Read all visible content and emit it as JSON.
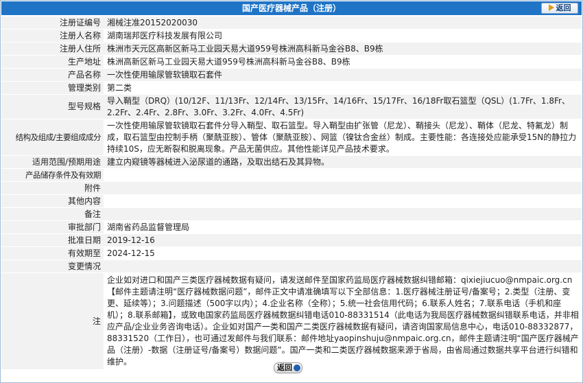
{
  "header": {
    "title": "国产医疗器械产品（注册）",
    "back_label": "返回"
  },
  "rows": [
    {
      "label": "注册证编号",
      "value": "湘械注准20152020030"
    },
    {
      "label": "注册人名称",
      "value": "湖南瑞邦医疗科技发展有限公司"
    },
    {
      "label": "注册人住所",
      "value": "株洲市天元区高新区新马工业园天易大道959号株洲高科新马金谷B8、B9栋"
    },
    {
      "label": "生产地址",
      "value": "株洲高新区新马工业园天易大道959号株洲高科新马金谷B8、B9栋"
    },
    {
      "label": "产品名称",
      "value": "一次性使用输尿管软镜取石套件"
    },
    {
      "label": "管理类别",
      "value": "第二类"
    },
    {
      "label": "型号规格",
      "value": "导入鞘型（DRQ）(10/12F、11/13Fr、12/14Fr、13/15Fr、14/16Fr、15/17Fr、16/18Fr取石篮型（QSL）(1.7Fr、1.8Fr、2.2Fr、2.4Fr、2.8Fr、3.0Fr、3.2Fr、4.0Fr、4.5Fr)"
    },
    {
      "label": "结构及组成/主要组成成分",
      "value": "一次性使用输尿管软镜取石套件分导入鞘型、取石篮型。导入鞘型由扩张管（尼龙）、鞘接头（尼龙）、鞘体（尼龙、特氟龙）制成，取石篮型由控制手柄（聚酰亚胺）、管体（聚酰亚胺）、网篮（镍钛合金丝）制成。主要性能：各连接处应能承受15N的静拉力持续10S，应无断裂和脱离现象。产品无菌供应。其他性能详见产品技术要求。"
    },
    {
      "label": "适用范围/预期用途",
      "value": "建立内窥镜等器械进入泌尿道的通路，及取出结石及其异物。"
    },
    {
      "label": "产品储存条件及有效期",
      "value": ""
    },
    {
      "label": "附件",
      "value": ""
    },
    {
      "label": "其他内容",
      "value": ""
    },
    {
      "label": "备注",
      "value": ""
    },
    {
      "label": "审批部门",
      "value": "湖南省药品监督管理局"
    },
    {
      "label": "批准日期",
      "value": "2019-12-16"
    },
    {
      "label": "有效期至",
      "value": "2024-12-15"
    },
    {
      "label": "变更情况",
      "value": ""
    }
  ],
  "note": {
    "label": "注",
    "text": "企业如对进口和国产三类医疗器械数据有疑问，请发送邮件至国家药监局医疗器械数据纠错邮箱：qixiejiucuo@nmpaic.org.cn【邮件主题请注明“医疗器械数据问题”，邮件正文中请准确填写以下全部信息：1.医疗器械注册证号/备案号；2.类型（注册、变更、延续等）；3.问题描述（500字以内）；4.企业名称（全称）；5.统一社会信用代码；6.联系人姓名；7.联系电话（手机和座机）；8.联系邮箱】，或致电国家药监局医疗器械数据纠错电话010-88331514（此电话为我局医疗器械数据纠错联系电话，并非相应产品/企业业务咨询电话）。企业如对国产一类和国产二类医疗器械数据有疑问，请咨询国家局信息中心，电话010-88332877，88331520（工作日），也可通过发邮件与我们联系：邮件地址yaopinshuju@nmpaic.org.cn，邮件主题请注明“国产医疗器械产品（注册）-数据（注册证号/备案号）数据问题”。国产一类和二类医疗器械数据来源于省局，由省局通过数据共享平台进行纠错和维护。"
  },
  "footer": {
    "back_label": "返回"
  }
}
